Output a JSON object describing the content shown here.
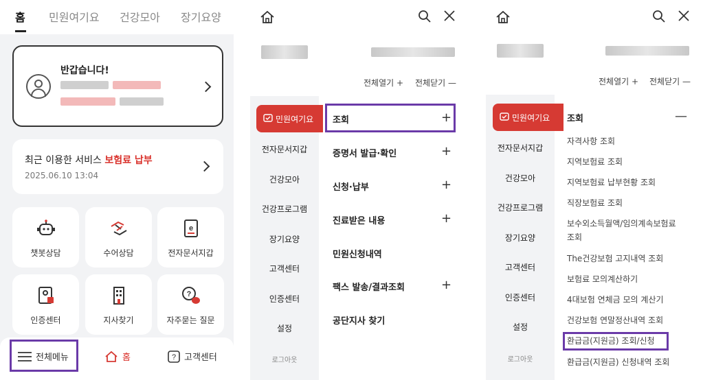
{
  "panel1": {
    "tabs": [
      "홈",
      "민원여기요",
      "건강모아",
      "장기요양"
    ],
    "welcome": {
      "greeting": "반갑습니다!"
    },
    "recent": {
      "prefix": "최근 이용한 서비스",
      "service": "보험료 납부",
      "date": "2025.06.10 13:04"
    },
    "tiles": [
      {
        "label": "챗봇상담",
        "icon": "chatbot-icon"
      },
      {
        "label": "수어상담",
        "icon": "sign-language-icon"
      },
      {
        "label": "전자문서지갑",
        "icon": "e-document-icon"
      },
      {
        "label": "인증센터",
        "icon": "certificate-icon"
      },
      {
        "label": "지사찾기",
        "icon": "building-icon"
      },
      {
        "label": "자주묻는 질문",
        "icon": "faq-icon"
      }
    ],
    "bottom": {
      "menu": "전체메뉴",
      "home": "홈",
      "support": "고객센터"
    }
  },
  "menu": {
    "expand_all": "전체열기 +",
    "collapse_all": "전체닫기 —",
    "left_items": [
      "민원여기요",
      "전자문서지갑",
      "건강모아",
      "건강프로그램",
      "장기요양",
      "고객센터",
      "인증센터",
      "설정",
      "로그아웃"
    ]
  },
  "panel2": {
    "right_items": [
      {
        "label": "조회",
        "plus": "+"
      },
      {
        "label": "증명서 발급·확인",
        "plus": "+"
      },
      {
        "label": "신청·납부",
        "plus": "+"
      },
      {
        "label": "진료받은 내용",
        "plus": "+"
      },
      {
        "label": "민원신청내역",
        "plus": ""
      },
      {
        "label": "팩스 발송/결과조회",
        "plus": "+"
      },
      {
        "label": "공단지사 찾기",
        "plus": ""
      }
    ]
  },
  "panel3": {
    "section": "조회",
    "collapse": "—",
    "sub_items": [
      "자격사항 조회",
      "지역보험료 조회",
      "지역보험료 납부현황 조회",
      "직장보험료 조회",
      "보수외소득월액/임의계속보험료",
      "조회",
      "The건강보험 고지내역 조회",
      "보험료 모의계산하기",
      "4대보험 연체금 모의 계산기",
      "건강보험 연말정산내역 조회",
      "환급금(지원금) 조회/신청",
      "환급금(지원금) 신청내역 조회"
    ]
  },
  "colors": {
    "accent": "#d63a33",
    "highlight": "#6a3aa8"
  }
}
